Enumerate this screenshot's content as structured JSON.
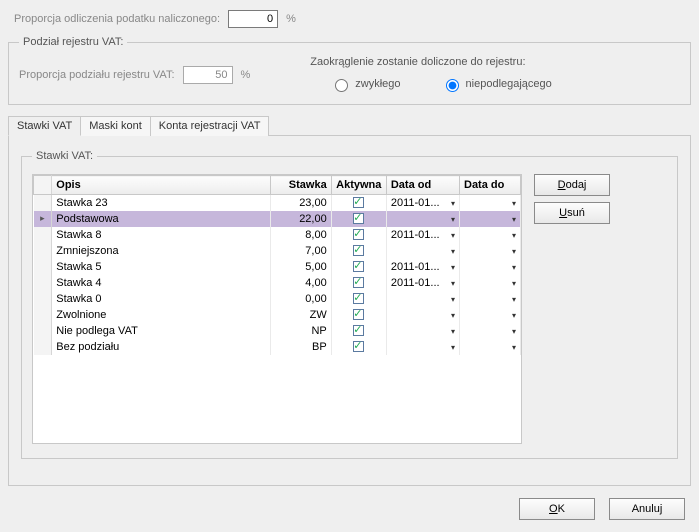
{
  "proporcja_odliczenia": {
    "label": "Proporcja odliczenia podatku naliczonego:",
    "value": "0",
    "suffix": "%"
  },
  "podzial": {
    "legend": "Podział rejestru VAT:",
    "proporcja_label": "Proporcja podziału rejestru VAT:",
    "proporcja_value": "50",
    "proporcja_suffix": "%",
    "zaokraglenie_label": "Zaokrąglenie zostanie doliczone do rejestru:",
    "radio1": "zwykłego",
    "radio2": "niepodlegającego",
    "radio_selected": "niepodlegajacego"
  },
  "tabs": {
    "t1": "Stawki VAT",
    "t2": "Maski kont",
    "t3": "Konta rejestracji VAT",
    "active": "t1"
  },
  "stawki": {
    "legend": "Stawki VAT:",
    "columns": {
      "opis": "Opis",
      "stawka": "Stawka",
      "aktywna": "Aktywna",
      "dataod": "Data od",
      "datado": "Data do"
    },
    "rows": [
      {
        "opis": "Stawka 23",
        "stawka": "23,00",
        "aktywna": true,
        "dataod": "2011-01...",
        "datado": ""
      },
      {
        "opis": "Podstawowa",
        "stawka": "22,00",
        "aktywna": true,
        "dataod": "",
        "datado": "",
        "selected": true
      },
      {
        "opis": "Stawka 8",
        "stawka": "8,00",
        "aktywna": true,
        "dataod": "2011-01...",
        "datado": ""
      },
      {
        "opis": "Zmniejszona",
        "stawka": "7,00",
        "aktywna": true,
        "dataod": "",
        "datado": ""
      },
      {
        "opis": "Stawka 5",
        "stawka": "5,00",
        "aktywna": true,
        "dataod": "2011-01...",
        "datado": ""
      },
      {
        "opis": "Stawka 4",
        "stawka": "4,00",
        "aktywna": true,
        "dataod": "2011-01...",
        "datado": ""
      },
      {
        "opis": "Stawka 0",
        "stawka": "0,00",
        "aktywna": true,
        "dataod": "",
        "datado": ""
      },
      {
        "opis": "Zwolnione",
        "stawka": "ZW",
        "aktywna": true,
        "dataod": "",
        "datado": ""
      },
      {
        "opis": "Nie podlega VAT",
        "stawka": "NP",
        "aktywna": true,
        "dataod": "",
        "datado": ""
      },
      {
        "opis": "Bez podziału",
        "stawka": "BP",
        "aktywna": true,
        "dataod": "",
        "datado": ""
      }
    ],
    "buttons": {
      "dodaj": "Dodaj",
      "usun": "Usuń"
    }
  },
  "footer": {
    "ok": "OK",
    "anuluj": "Anuluj"
  }
}
